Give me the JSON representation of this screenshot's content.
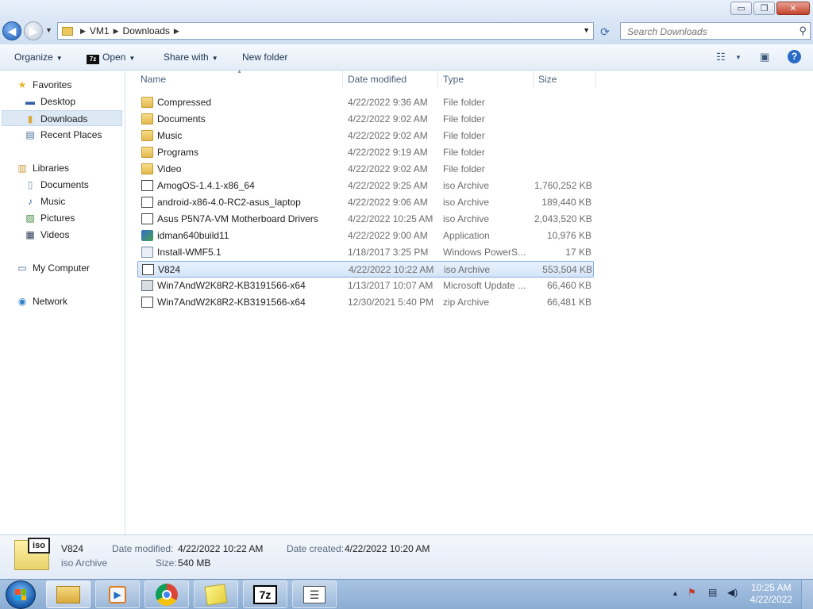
{
  "window": {
    "controls": {
      "minimize": "▭",
      "maximize": "❐",
      "close": "✕"
    }
  },
  "address": {
    "back_icon": "back-arrow-icon",
    "forward_icon": "forward-arrow-icon",
    "crumbs": [
      "VM1",
      "Downloads"
    ],
    "search_placeholder": "Search Downloads"
  },
  "toolbar": {
    "organize": "Organize",
    "open": "Open",
    "open_icon_text": "7z",
    "share_with": "Share with",
    "new_folder": "New folder"
  },
  "sidebar": {
    "favorites": "Favorites",
    "desktop": "Desktop",
    "downloads": "Downloads",
    "recent_places": "Recent Places",
    "libraries": "Libraries",
    "documents": "Documents",
    "music": "Music",
    "pictures": "Pictures",
    "videos": "Videos",
    "my_computer": "My Computer",
    "network": "Network"
  },
  "columns": {
    "name": "Name",
    "date": "Date modified",
    "type": "Type",
    "size": "Size"
  },
  "files": [
    {
      "name": "Compressed",
      "date": "4/22/2022 9:36 AM",
      "type": "File folder",
      "size": "",
      "icon": "folder"
    },
    {
      "name": "Documents",
      "date": "4/22/2022 9:02 AM",
      "type": "File folder",
      "size": "",
      "icon": "folder"
    },
    {
      "name": "Music",
      "date": "4/22/2022 9:02 AM",
      "type": "File folder",
      "size": "",
      "icon": "folder"
    },
    {
      "name": "Programs",
      "date": "4/22/2022 9:19 AM",
      "type": "File folder",
      "size": "",
      "icon": "folder"
    },
    {
      "name": "Video",
      "date": "4/22/2022 9:02 AM",
      "type": "File folder",
      "size": "",
      "icon": "folder"
    },
    {
      "name": "AmogOS-1.4.1-x86_64",
      "date": "4/22/2022 9:25 AM",
      "type": "iso Archive",
      "size": "1,760,252 KB",
      "icon": "iso"
    },
    {
      "name": "android-x86-4.0-RC2-asus_laptop",
      "date": "4/22/2022 9:06 AM",
      "type": "iso Archive",
      "size": "189,440 KB",
      "icon": "iso"
    },
    {
      "name": "Asus P5N7A-VM Motherboard Drivers",
      "date": "4/22/2022 10:25 AM",
      "type": "iso Archive",
      "size": "2,043,520 KB",
      "icon": "iso"
    },
    {
      "name": "idman640build11",
      "date": "4/22/2022 9:00 AM",
      "type": "Application",
      "size": "10,976 KB",
      "icon": "app"
    },
    {
      "name": "Install-WMF5.1",
      "date": "1/18/2017 3:25 PM",
      "type": "Windows PowerS...",
      "size": "17 KB",
      "icon": "ps"
    },
    {
      "name": "V824",
      "date": "4/22/2022 10:22 AM",
      "type": "iso Archive",
      "size": "553,504 KB",
      "icon": "iso",
      "selected": true
    },
    {
      "name": "Win7AndW2K8R2-KB3191566-x64",
      "date": "1/13/2017 10:07 AM",
      "type": "Microsoft Update ...",
      "size": "66,460 KB",
      "icon": "msu"
    },
    {
      "name": "Win7AndW2K8R2-KB3191566-x64",
      "date": "12/30/2021 5:40 PM",
      "type": "zip Archive",
      "size": "66,481 KB",
      "icon": "zip"
    }
  ],
  "details": {
    "name": "V824",
    "type": "iso Archive",
    "date_modified_label": "Date modified:",
    "date_modified": "4/22/2022 10:22 AM",
    "date_created_label": "Date created:",
    "date_created": "4/22/2022 10:20 AM",
    "size_label": "Size:",
    "size": "540 MB",
    "icon_text": "iso"
  },
  "taskbar": {
    "apps": [
      "windows-explorer",
      "media-player",
      "chrome",
      "sticky-notes",
      "7-zip",
      "notepad"
    ],
    "sevenzip_label": "7z",
    "time": "10:25 AM",
    "date": "4/22/2022"
  }
}
